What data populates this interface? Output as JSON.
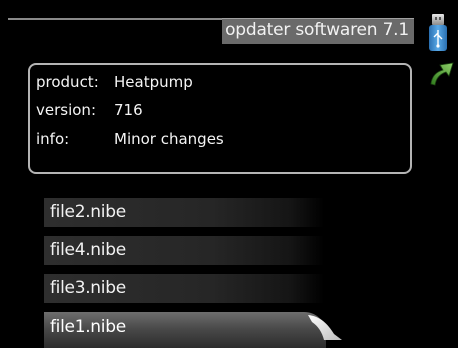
{
  "header": {
    "title": "opdater softwaren 7.1"
  },
  "icons": {
    "usb": "usb-icon",
    "back": "back-arrow-icon"
  },
  "info": {
    "rows": [
      {
        "label": "product:",
        "value": "Heatpump"
      },
      {
        "label": "version:",
        "value": "716"
      },
      {
        "label": "info:",
        "value": "Minor changes"
      }
    ]
  },
  "files": {
    "items": [
      {
        "label": "file2.nibe"
      },
      {
        "label": "file4.nibe"
      },
      {
        "label": "file3.nibe"
      },
      {
        "label": "file1.nibe"
      }
    ],
    "selected": "file1.nibe"
  },
  "colors": {
    "background": "#000000",
    "title_bar": "#6a6a6a",
    "usb_blue": "#3f8fd0",
    "back_green": "#4a9a30"
  }
}
